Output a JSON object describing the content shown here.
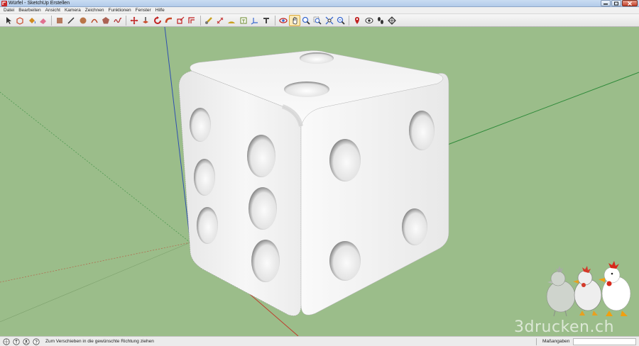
{
  "window": {
    "title": "Würfel - SketchUp Erstellen"
  },
  "menu": {
    "items": [
      "Datei",
      "Bearbeiten",
      "Ansicht",
      "Kamera",
      "Zeichnen",
      "Funktionen",
      "Fenster",
      "Hilfe"
    ]
  },
  "toolbar": {
    "tools": [
      {
        "name": "select-tool-icon",
        "color": "#333333"
      },
      {
        "name": "make-component-icon",
        "color": "#c84a2a"
      },
      {
        "name": "paint-bucket-icon",
        "color": "#d08a20"
      },
      {
        "name": "eraser-icon",
        "color": "#e07090"
      },
      {
        "name": "rectangle-tool-icon",
        "color": "#a85c3a"
      },
      {
        "name": "line-tool-icon",
        "color": "#333333"
      },
      {
        "name": "circle-tool-icon",
        "color": "#b0602a"
      },
      {
        "name": "arc-tool-icon",
        "color": "#b84a2a"
      },
      {
        "name": "polygon-tool-icon",
        "color": "#a04a3a"
      },
      {
        "name": "freehand-tool-icon",
        "color": "#b03030"
      },
      {
        "name": "move-tool-icon",
        "color": "#c02020"
      },
      {
        "name": "push-pull-icon",
        "color": "#c84a2a"
      },
      {
        "name": "rotate-tool-icon",
        "color": "#c02020"
      },
      {
        "name": "follow-me-icon",
        "color": "#c84a2a"
      },
      {
        "name": "scale-tool-icon",
        "color": "#c02020"
      },
      {
        "name": "offset-tool-icon",
        "color": "#c02020"
      },
      {
        "name": "tape-measure-icon",
        "color": "#c8a020"
      },
      {
        "name": "dimension-tool-icon",
        "color": "#c02020"
      },
      {
        "name": "protractor-icon",
        "color": "#c8a020"
      },
      {
        "name": "text-tool-icon",
        "color": "#6a8a2a"
      },
      {
        "name": "axes-tool-icon",
        "color": "#3a6ad0"
      },
      {
        "name": "3d-text-icon",
        "color": "#444444"
      },
      {
        "name": "orbit-tool-icon",
        "color": "#c02020"
      },
      {
        "name": "pan-tool-icon",
        "color": "#333333"
      },
      {
        "name": "zoom-tool-icon",
        "color": "#3a6ad0"
      },
      {
        "name": "zoom-window-icon",
        "color": "#3a6ad0"
      },
      {
        "name": "zoom-extents-icon",
        "color": "#3a6ad0"
      },
      {
        "name": "previous-view-icon",
        "color": "#3a6ad0"
      },
      {
        "name": "position-camera-icon",
        "color": "#c02020"
      },
      {
        "name": "look-around-icon",
        "color": "#333333"
      },
      {
        "name": "walk-tool-icon",
        "color": "#333333"
      },
      {
        "name": "section-plane-icon",
        "color": "#333333"
      }
    ],
    "active_index": 23
  },
  "watermark": "3drucken.ch",
  "status": {
    "text": "Zum Verschieben in die gewünschte Richtung ziehen",
    "measure_label": "Maßangaben",
    "measure_value": ""
  },
  "colors": {
    "ground": "#9bbd8a",
    "red_axis": "#c0392b",
    "green_axis": "#2f8a3a",
    "blue_axis": "#2e4fb0"
  }
}
